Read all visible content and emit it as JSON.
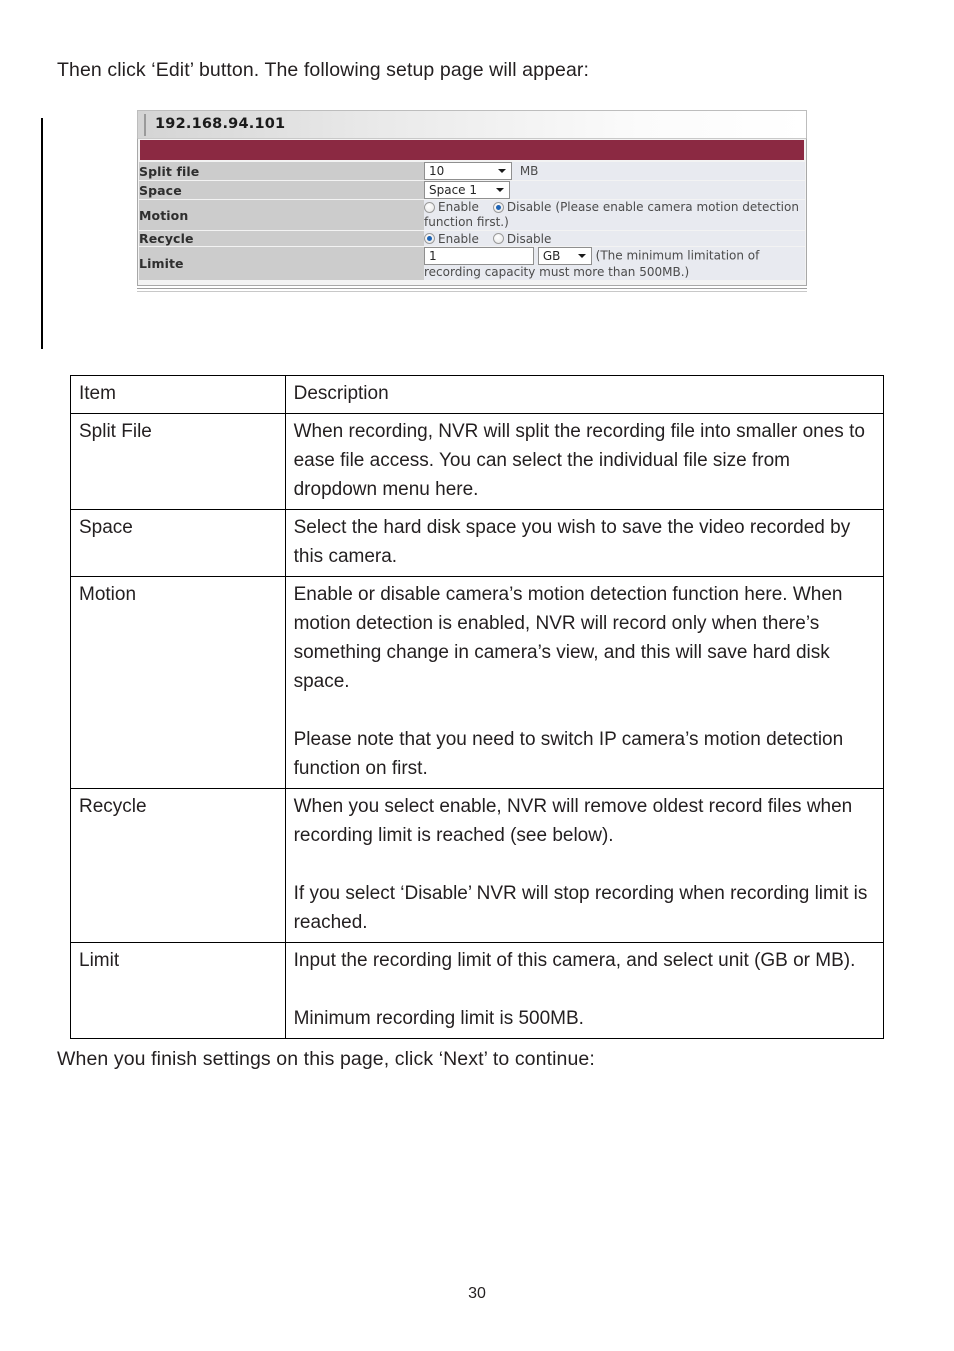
{
  "document": {
    "intro_paragraph": "Then click ‘Edit’ button. The following setup page will appear:",
    "outro_paragraph": "When you finish settings on this page, click ‘Next’ to continue:",
    "page_number": "30"
  },
  "colors": {
    "title_bar": "#8b2942",
    "label_cell": "#cccccc",
    "value_cell": "#e8eaf0",
    "radio_selected_dot": "#1d63b5"
  },
  "figure": {
    "device_ip": "192.168.94.101",
    "rows": {
      "split_file": {
        "label": "Split file",
        "select_value": "10",
        "unit_suffix": "MB"
      },
      "space": {
        "label": "Space",
        "select_value": "Space 1"
      },
      "motion": {
        "label": "Motion",
        "enable_label": "Enable",
        "disable_label": "Disable",
        "enable_selected": false,
        "disable_selected": true,
        "hint": "(Please enable camera motion detection function first.)"
      },
      "recycle": {
        "label": "Recycle",
        "enable_label": "Enable",
        "disable_label": "Disable",
        "enable_selected": true,
        "disable_selected": false
      },
      "limite": {
        "label": "Limite",
        "input_value": "1",
        "unit_value": "GB",
        "hint": "(The minimum limitation of recording capacity must more than 500MB.)"
      }
    }
  },
  "desc_table": {
    "headers": {
      "item": "Item",
      "description": "Description"
    },
    "rows": [
      {
        "item": "Split File",
        "paragraphs": [
          "When recording, NVR will split the recording file into smaller ones to ease file access. You can select the individual file size from dropdown menu here."
        ]
      },
      {
        "item": "Space",
        "paragraphs": [
          "Select the hard disk space you wish to save the video recorded by this camera."
        ]
      },
      {
        "item": "Motion",
        "paragraphs": [
          "Enable or disable camera’s motion detection function here. When motion detection is enabled, NVR will record only when there’s something change in camera’s view, and this will save hard disk space.",
          "Please note that you need to switch IP camera’s motion detection function on first."
        ]
      },
      {
        "item": "Recycle",
        "paragraphs": [
          "When you select enable, NVR will remove oldest record files when recording limit is reached (see below).",
          "If you select ‘Disable’ NVR will stop recording when recording limit is reached."
        ]
      },
      {
        "item": "Limit",
        "paragraphs": [
          "Input the recording limit of this camera, and select unit (GB or MB).",
          "Minimum recording limit is 500MB."
        ]
      }
    ]
  }
}
